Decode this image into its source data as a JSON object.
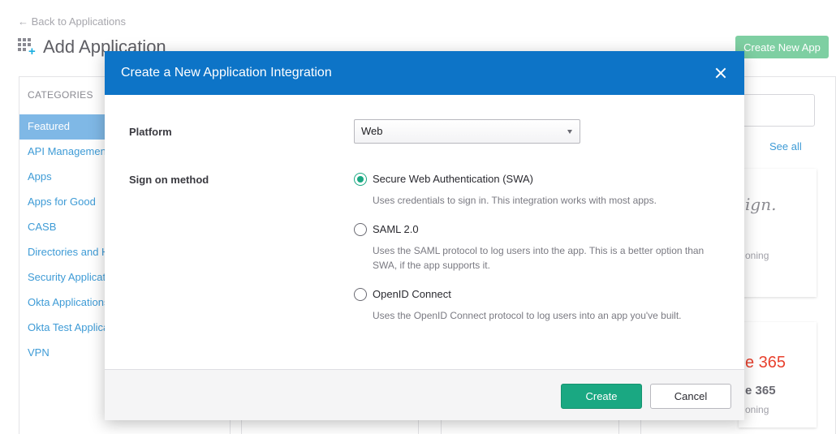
{
  "background": {
    "back_link": "← Back to Applications",
    "page_title": "Add Application",
    "create_new_app": "Create New App",
    "categories_heading": "CATEGORIES",
    "categories": [
      {
        "label": "Featured",
        "active": true
      },
      {
        "label": "API Management",
        "active": false
      },
      {
        "label": "Apps",
        "active": false
      },
      {
        "label": "Apps for Good",
        "active": false
      },
      {
        "label": "CASB",
        "active": false
      },
      {
        "label": "Directories and HR Systems",
        "active": false
      },
      {
        "label": "Security Applications",
        "active": false
      },
      {
        "label": "Okta Applications",
        "active": false
      },
      {
        "label": "Okta Test Applications",
        "active": false
      },
      {
        "label": "VPN",
        "active": false
      }
    ],
    "see_all": "See all",
    "card1_logo": "ign.",
    "card1_sub": "oning",
    "card2_logo": "e 365",
    "card2_name": "e 365",
    "card2_sub": "oning"
  },
  "modal": {
    "title": "Create a New Application Integration",
    "platform_label": "Platform",
    "platform_value": "Web",
    "signon_label": "Sign on method",
    "options": [
      {
        "label": "Secure Web Authentication (SWA)",
        "description": "Uses credentials to sign in. This integration works with most apps.",
        "checked": true
      },
      {
        "label": "SAML 2.0",
        "description": "Uses the SAML protocol to log users into the app. This is a better option than SWA, if the app supports it.",
        "checked": false
      },
      {
        "label": "OpenID Connect",
        "description": "Uses the OpenID Connect protocol to log users into an app you've built.",
        "checked": false
      }
    ],
    "create_label": "Create",
    "cancel_label": "Cancel"
  },
  "colors": {
    "header_blue": "#0d74c7",
    "primary_green": "#1aa882",
    "link_blue": "#3e9bd6"
  }
}
